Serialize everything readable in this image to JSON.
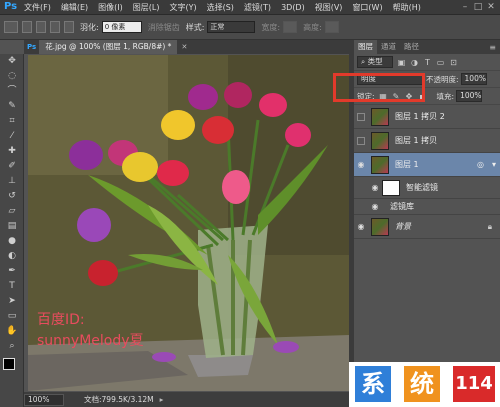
{
  "app": {
    "logo": "Ps"
  },
  "menu": [
    "文件(F)",
    "编辑(E)",
    "图像(I)",
    "图层(L)",
    "文字(Y)",
    "选择(S)",
    "滤镜(T)",
    "3D(D)",
    "视图(V)",
    "窗口(W)",
    "帮助(H)"
  ],
  "options": {
    "feather_label": "羽化:",
    "feather_value": "0 像素",
    "antialias_label": "消除锯齿",
    "style_label": "样式:",
    "style_value": "正常",
    "width_label": "宽度:",
    "height_label": "高度:"
  },
  "document": {
    "tab_title": "花.jpg @ 100% (图层 1, RGB/8#) *",
    "watermark_line1": "百度ID:",
    "watermark_line2": "sunnyMelody夏"
  },
  "status": {
    "zoom": "100%",
    "doc": "文档:799.5K/3.12M"
  },
  "panel": {
    "tabs": [
      "图层",
      "通道",
      "路径"
    ],
    "filter_label": "类型",
    "blend_mode": "明度",
    "opacity_label": "不透明度:",
    "opacity_value": "100%",
    "lock_label": "锁定:",
    "fill_label": "填充:",
    "fill_value": "100%",
    "layers": [
      {
        "name": "图层 1 拷贝 2",
        "visible": false
      },
      {
        "name": "图层 1 拷贝",
        "visible": false
      },
      {
        "name": "图层 1",
        "visible": true,
        "selected": true
      },
      {
        "name": "智能滤镜",
        "visible": true,
        "sub": true
      },
      {
        "name": "滤镜库",
        "visible": true,
        "sub": true
      },
      {
        "name": "背景",
        "visible": true,
        "locked": true
      }
    ]
  },
  "logo_text": [
    "系",
    "统",
    "114"
  ],
  "colors": {
    "logo_blue": "#2f7fd8",
    "logo_orange": "#f0921e",
    "logo_red": "#d92a2a",
    "highlight_red": "#e23a2b"
  }
}
